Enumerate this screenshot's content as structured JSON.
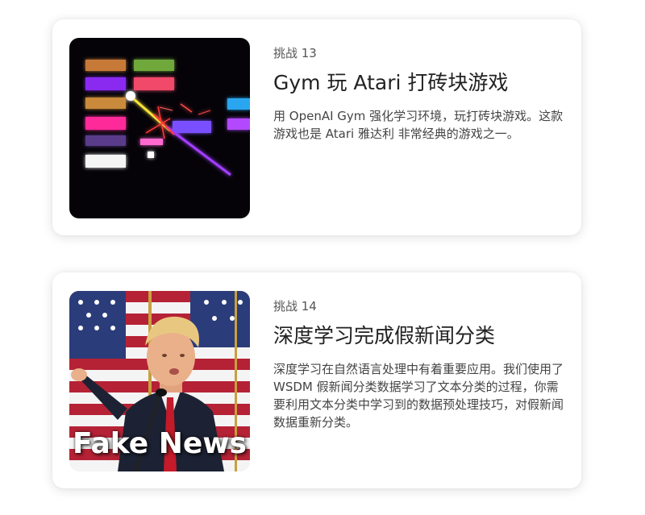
{
  "cards": [
    {
      "label": "挑战 13",
      "title": "Gym 玩 Atari 打砖块游戏",
      "description": "用 OpenAI Gym 强化学习环境，玩打砖块游戏。这款游戏也是 Atari 雅达利 非常经典的游戏之一。",
      "image_alt": "atari-breakout-image"
    },
    {
      "label": "挑战 14",
      "title": "深度学习完成假新闻分类",
      "description": "深度学习在自然语言处理中有着重要应用。我们使用了 WSDM 假新闻分类数据学习了文本分类的过程，你需要利用文本分类中学习到的数据预处理技巧，对假新闻数据重新分类。",
      "image_caption": "Fake News"
    }
  ]
}
